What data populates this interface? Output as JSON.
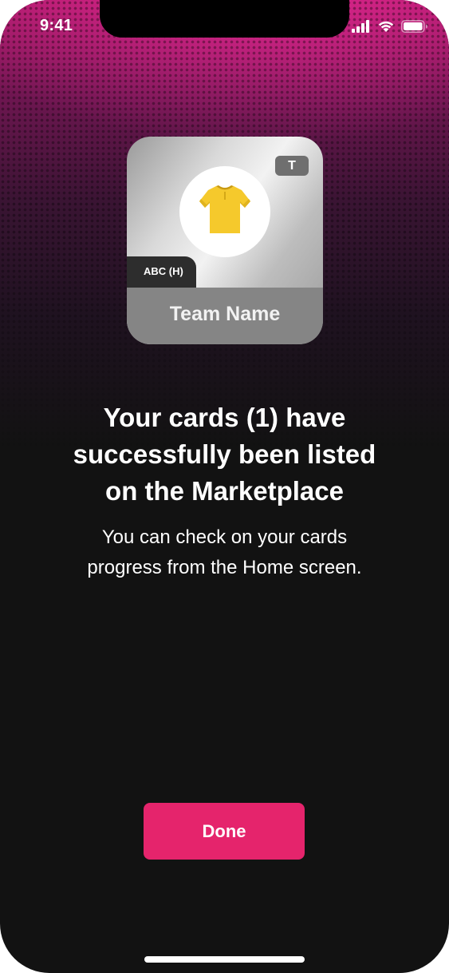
{
  "status_bar": {
    "time": "9:41",
    "icons": [
      "cellular-signal-icon",
      "wifi-icon",
      "battery-icon"
    ]
  },
  "card": {
    "badge": "T",
    "jersey_icon": "jersey-icon",
    "jersey_color": "#f5c92c",
    "position_tag": "ABC (H)",
    "team_name": "Team Name"
  },
  "confirmation": {
    "headline_line1": "Your cards (1) have",
    "headline_line2": "successfully been listed",
    "headline_line3": "on the Marketplace",
    "subtext_line1": "You can check on your cards",
    "subtext_line2": "progress from the Home screen."
  },
  "actions": {
    "done_label": "Done"
  },
  "colors": {
    "accent": "#e5246c",
    "background": "#121212",
    "gradient_top": "#b01c6e"
  }
}
